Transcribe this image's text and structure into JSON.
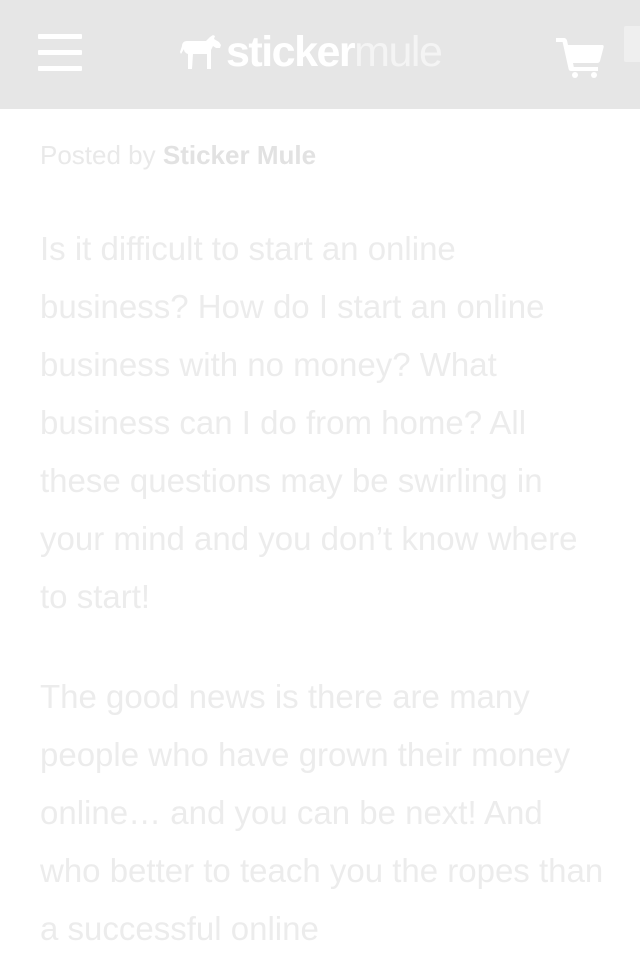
{
  "header": {
    "menu_icon": "hamburger-menu-icon",
    "logo": {
      "part1": "sticker",
      "part2": "mule",
      "icon": "mule-icon"
    },
    "cart_icon": "shopping-cart-icon"
  },
  "post": {
    "posted_by_label": "Posted by",
    "author": "Sticker Mule",
    "paragraphs": [
      "Is it difficult to start an online business? How do I start an online business with no money? What business can I do from home? All these questions may be swirling in your mind and you don’t know where to start!",
      "The good news is there are many people who have grown their money online… and you can be next! And who better to teach you the ropes than a successful online"
    ]
  },
  "colors": {
    "header_background": "#e6e6e6",
    "page_background": "#ffffff",
    "text": "#ececec"
  }
}
